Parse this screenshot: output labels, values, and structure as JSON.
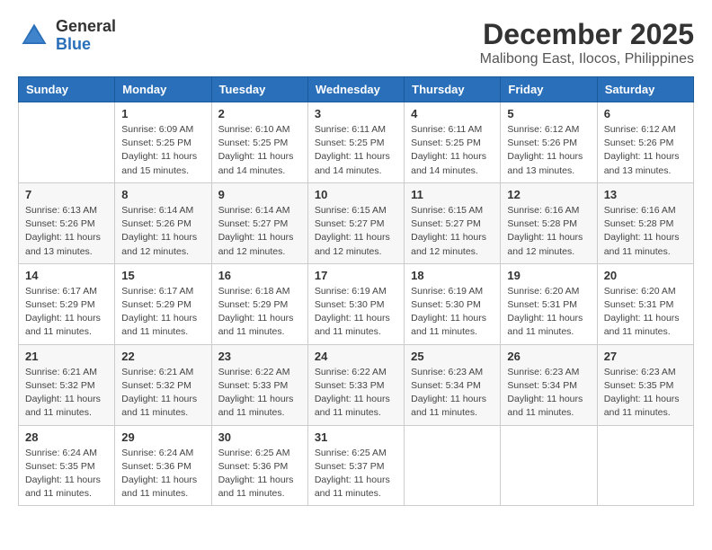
{
  "logo": {
    "general": "General",
    "blue": "Blue"
  },
  "title": {
    "month": "December 2025",
    "location": "Malibong East, Ilocos, Philippines"
  },
  "days_of_week": [
    "Sunday",
    "Monday",
    "Tuesday",
    "Wednesday",
    "Thursday",
    "Friday",
    "Saturday"
  ],
  "weeks": [
    [
      {
        "day": "",
        "info": ""
      },
      {
        "day": "1",
        "info": "Sunrise: 6:09 AM\nSunset: 5:25 PM\nDaylight: 11 hours and 15 minutes."
      },
      {
        "day": "2",
        "info": "Sunrise: 6:10 AM\nSunset: 5:25 PM\nDaylight: 11 hours and 14 minutes."
      },
      {
        "day": "3",
        "info": "Sunrise: 6:11 AM\nSunset: 5:25 PM\nDaylight: 11 hours and 14 minutes."
      },
      {
        "day": "4",
        "info": "Sunrise: 6:11 AM\nSunset: 5:25 PM\nDaylight: 11 hours and 14 minutes."
      },
      {
        "day": "5",
        "info": "Sunrise: 6:12 AM\nSunset: 5:26 PM\nDaylight: 11 hours and 13 minutes."
      },
      {
        "day": "6",
        "info": "Sunrise: 6:12 AM\nSunset: 5:26 PM\nDaylight: 11 hours and 13 minutes."
      }
    ],
    [
      {
        "day": "7",
        "info": "Sunrise: 6:13 AM\nSunset: 5:26 PM\nDaylight: 11 hours and 13 minutes."
      },
      {
        "day": "8",
        "info": "Sunrise: 6:14 AM\nSunset: 5:26 PM\nDaylight: 11 hours and 12 minutes."
      },
      {
        "day": "9",
        "info": "Sunrise: 6:14 AM\nSunset: 5:27 PM\nDaylight: 11 hours and 12 minutes."
      },
      {
        "day": "10",
        "info": "Sunrise: 6:15 AM\nSunset: 5:27 PM\nDaylight: 11 hours and 12 minutes."
      },
      {
        "day": "11",
        "info": "Sunrise: 6:15 AM\nSunset: 5:27 PM\nDaylight: 11 hours and 12 minutes."
      },
      {
        "day": "12",
        "info": "Sunrise: 6:16 AM\nSunset: 5:28 PM\nDaylight: 11 hours and 12 minutes."
      },
      {
        "day": "13",
        "info": "Sunrise: 6:16 AM\nSunset: 5:28 PM\nDaylight: 11 hours and 11 minutes."
      }
    ],
    [
      {
        "day": "14",
        "info": "Sunrise: 6:17 AM\nSunset: 5:29 PM\nDaylight: 11 hours and 11 minutes."
      },
      {
        "day": "15",
        "info": "Sunrise: 6:17 AM\nSunset: 5:29 PM\nDaylight: 11 hours and 11 minutes."
      },
      {
        "day": "16",
        "info": "Sunrise: 6:18 AM\nSunset: 5:29 PM\nDaylight: 11 hours and 11 minutes."
      },
      {
        "day": "17",
        "info": "Sunrise: 6:19 AM\nSunset: 5:30 PM\nDaylight: 11 hours and 11 minutes."
      },
      {
        "day": "18",
        "info": "Sunrise: 6:19 AM\nSunset: 5:30 PM\nDaylight: 11 hours and 11 minutes."
      },
      {
        "day": "19",
        "info": "Sunrise: 6:20 AM\nSunset: 5:31 PM\nDaylight: 11 hours and 11 minutes."
      },
      {
        "day": "20",
        "info": "Sunrise: 6:20 AM\nSunset: 5:31 PM\nDaylight: 11 hours and 11 minutes."
      }
    ],
    [
      {
        "day": "21",
        "info": "Sunrise: 6:21 AM\nSunset: 5:32 PM\nDaylight: 11 hours and 11 minutes."
      },
      {
        "day": "22",
        "info": "Sunrise: 6:21 AM\nSunset: 5:32 PM\nDaylight: 11 hours and 11 minutes."
      },
      {
        "day": "23",
        "info": "Sunrise: 6:22 AM\nSunset: 5:33 PM\nDaylight: 11 hours and 11 minutes."
      },
      {
        "day": "24",
        "info": "Sunrise: 6:22 AM\nSunset: 5:33 PM\nDaylight: 11 hours and 11 minutes."
      },
      {
        "day": "25",
        "info": "Sunrise: 6:23 AM\nSunset: 5:34 PM\nDaylight: 11 hours and 11 minutes."
      },
      {
        "day": "26",
        "info": "Sunrise: 6:23 AM\nSunset: 5:34 PM\nDaylight: 11 hours and 11 minutes."
      },
      {
        "day": "27",
        "info": "Sunrise: 6:23 AM\nSunset: 5:35 PM\nDaylight: 11 hours and 11 minutes."
      }
    ],
    [
      {
        "day": "28",
        "info": "Sunrise: 6:24 AM\nSunset: 5:35 PM\nDaylight: 11 hours and 11 minutes."
      },
      {
        "day": "29",
        "info": "Sunrise: 6:24 AM\nSunset: 5:36 PM\nDaylight: 11 hours and 11 minutes."
      },
      {
        "day": "30",
        "info": "Sunrise: 6:25 AM\nSunset: 5:36 PM\nDaylight: 11 hours and 11 minutes."
      },
      {
        "day": "31",
        "info": "Sunrise: 6:25 AM\nSunset: 5:37 PM\nDaylight: 11 hours and 11 minutes."
      },
      {
        "day": "",
        "info": ""
      },
      {
        "day": "",
        "info": ""
      },
      {
        "day": "",
        "info": ""
      }
    ]
  ]
}
